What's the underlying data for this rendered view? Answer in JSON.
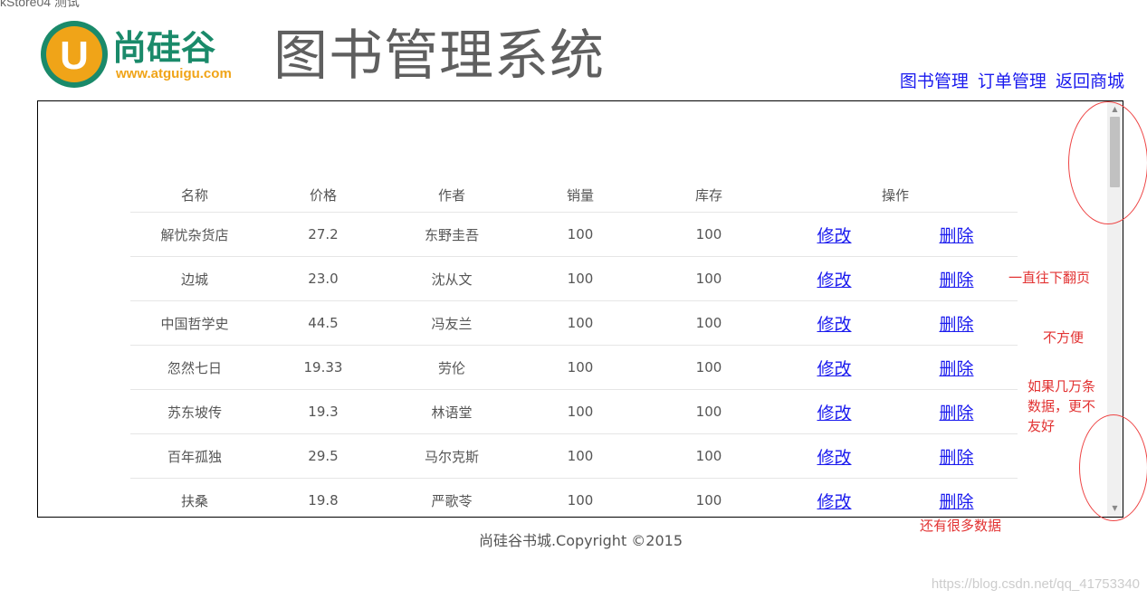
{
  "browser_tab_fragment": "kStore04   测试",
  "logo": {
    "brand": "尚硅谷",
    "url": "www.atguigu.com",
    "glyph": "U"
  },
  "header": {
    "title": "图书管理系统"
  },
  "nav": [
    {
      "label": "图书管理"
    },
    {
      "label": "订单管理"
    },
    {
      "label": "返回商城"
    }
  ],
  "table": {
    "headers": [
      "名称",
      "价格",
      "作者",
      "销量",
      "库存",
      "操作"
    ],
    "rows": [
      {
        "name": "解忧杂货店",
        "price": "27.2",
        "author": "东野圭吾",
        "sales": "100",
        "stock": "100",
        "edit": "修改",
        "delete": "删除"
      },
      {
        "name": "边城",
        "price": "23.0",
        "author": "沈从文",
        "sales": "100",
        "stock": "100",
        "edit": "修改",
        "delete": "删除"
      },
      {
        "name": "中国哲学史",
        "price": "44.5",
        "author": "冯友兰",
        "sales": "100",
        "stock": "100",
        "edit": "修改",
        "delete": "删除"
      },
      {
        "name": "忽然七日",
        "price": "19.33",
        "author": "劳伦",
        "sales": "100",
        "stock": "100",
        "edit": "修改",
        "delete": "删除"
      },
      {
        "name": "苏东坡传",
        "price": "19.3",
        "author": "林语堂",
        "sales": "100",
        "stock": "100",
        "edit": "修改",
        "delete": "删除"
      },
      {
        "name": "百年孤独",
        "price": "29.5",
        "author": "马尔克斯",
        "sales": "100",
        "stock": "100",
        "edit": "修改",
        "delete": "删除"
      },
      {
        "name": "扶桑",
        "price": "19.8",
        "author": "严歌苓",
        "sales": "100",
        "stock": "100",
        "edit": "修改",
        "delete": "删除"
      }
    ]
  },
  "footer": {
    "text": "尚硅谷书城.Copyright ©2015"
  },
  "annotations": {
    "a1": "一直往下翻页",
    "a2": "不方便",
    "a3_line1": "如果几万条",
    "a3_line2": "数据，更不",
    "a3_line3": "友好",
    "a4": "还有很多数据"
  },
  "watermark": "https://blog.csdn.net/qq_41753340",
  "colors": {
    "link": "#1a1aee",
    "annotation": "#e23232",
    "logo_orange": "#f0a418",
    "logo_teal": "#1a8a6a"
  }
}
